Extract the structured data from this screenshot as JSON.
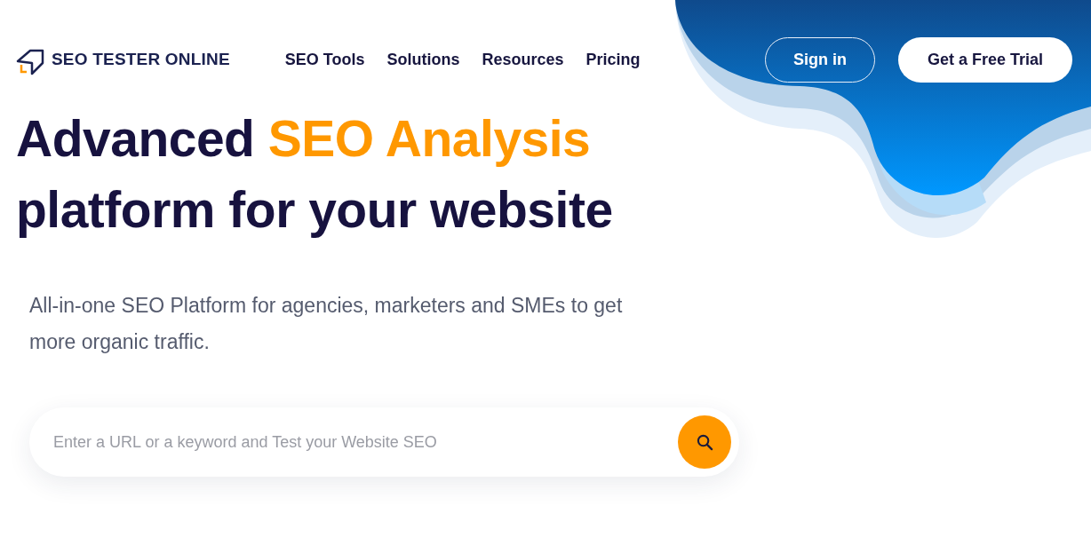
{
  "logo": {
    "text": "SEO TESTER ONLINE"
  },
  "nav": [
    {
      "label": "SEO Tools"
    },
    {
      "label": "Solutions"
    },
    {
      "label": "Resources"
    },
    {
      "label": "Pricing"
    }
  ],
  "actions": [
    {
      "label": "Sign in",
      "kind": "outline"
    },
    {
      "label": "Get a Free Trial",
      "kind": "solid"
    }
  ],
  "headline": [
    {
      "text": "Advanced ",
      "highlighted": false
    },
    {
      "text": "SEO Analysis",
      "highlighted": true
    },
    {
      "text": " platform for your website",
      "highlighted": false
    }
  ],
  "subtitle": "All-in-one SEO Platform for agencies, marketers and SMEs to get more organic traffic.",
  "search": {
    "placeholder": "Enter a URL or a keyword and Test your Website SEO"
  }
}
